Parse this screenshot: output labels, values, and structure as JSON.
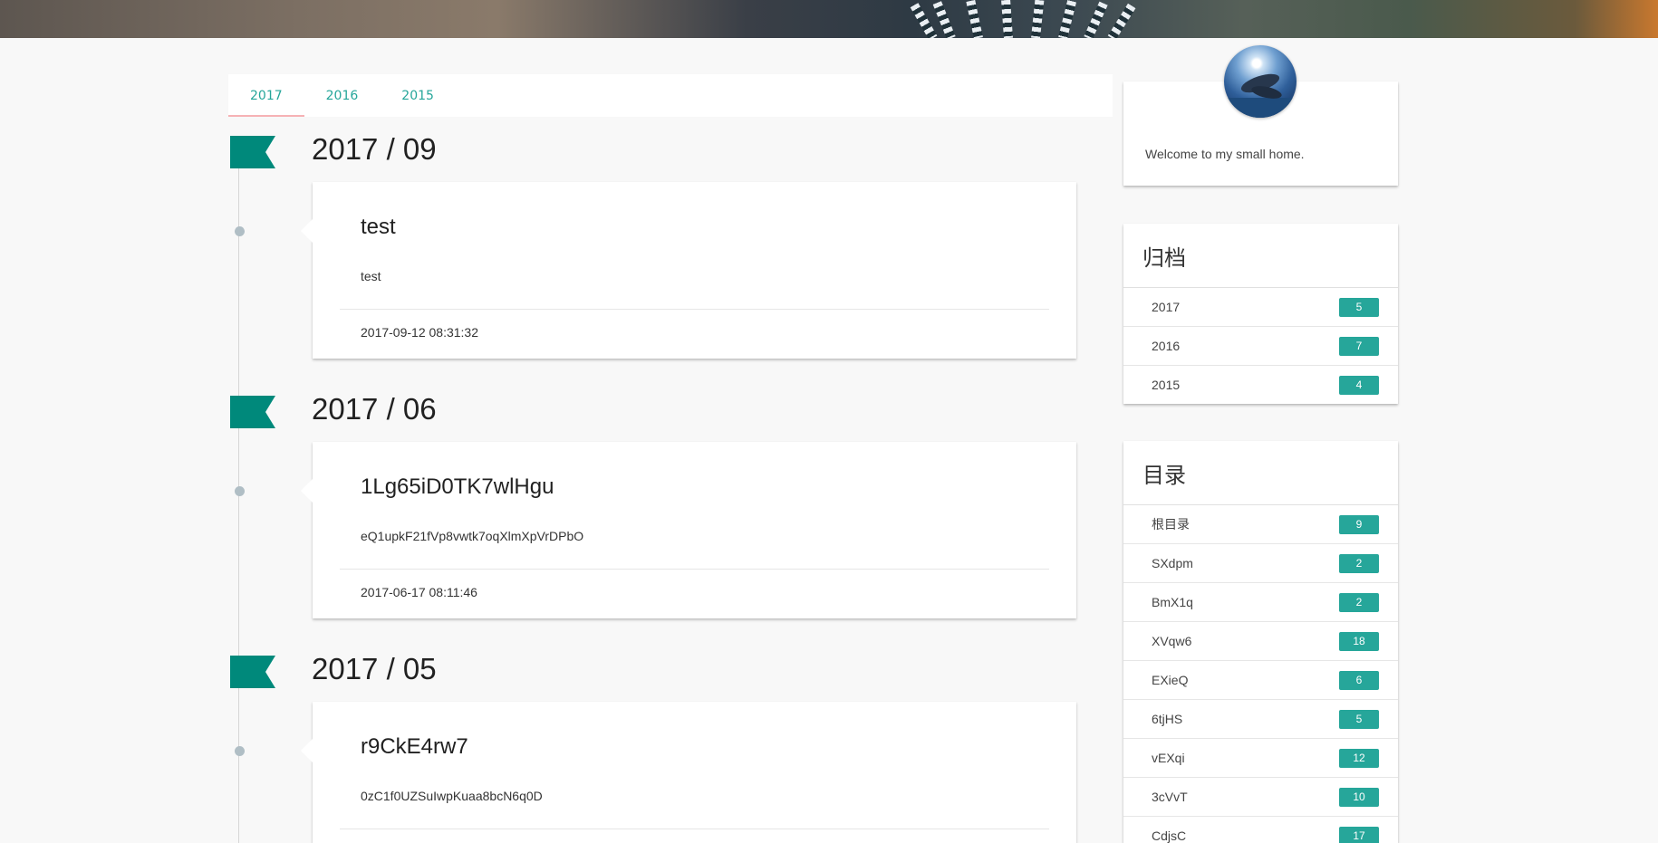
{
  "tabs": [
    {
      "label": "2017"
    },
    {
      "label": "2016"
    },
    {
      "label": "2015"
    }
  ],
  "timeline": [
    {
      "month": "2017 / 09",
      "post": {
        "title": "test",
        "summary": "test",
        "date": "2017-09-12 08:31:32"
      }
    },
    {
      "month": "2017 / 06",
      "post": {
        "title": "1Lg65iD0TK7wlHgu",
        "summary": "eQ1upkF21fVp8vwtk7oqXlmXpVrDPbO",
        "date": "2017-06-17 08:11:46"
      }
    },
    {
      "month": "2017 / 05",
      "post": {
        "title": "r9CkE4rw7",
        "summary": "0zC1f0UZSuIwpKuaa8bcN6q0D",
        "date": ""
      }
    }
  ],
  "profile": {
    "welcome": "Welcome to my small home."
  },
  "archive": {
    "title": "归档",
    "items": [
      {
        "label": "2017",
        "count": "5"
      },
      {
        "label": "2016",
        "count": "7"
      },
      {
        "label": "2015",
        "count": "4"
      }
    ]
  },
  "catalog": {
    "title": "目录",
    "items": [
      {
        "label": "根目录",
        "count": "9"
      },
      {
        "label": "SXdpm",
        "count": "2"
      },
      {
        "label": "BmX1q",
        "count": "2"
      },
      {
        "label": "XVqw6",
        "count": "18"
      },
      {
        "label": "EXieQ",
        "count": "6"
      },
      {
        "label": "6tjHS",
        "count": "5"
      },
      {
        "label": "vEXqi",
        "count": "12"
      },
      {
        "label": "3cVvT",
        "count": "10"
      },
      {
        "label": "CdjsC",
        "count": "17"
      }
    ]
  },
  "colors": {
    "accent": "#26a69a",
    "flag": "#00897b",
    "tab_indicator": "#f6b2b5"
  }
}
